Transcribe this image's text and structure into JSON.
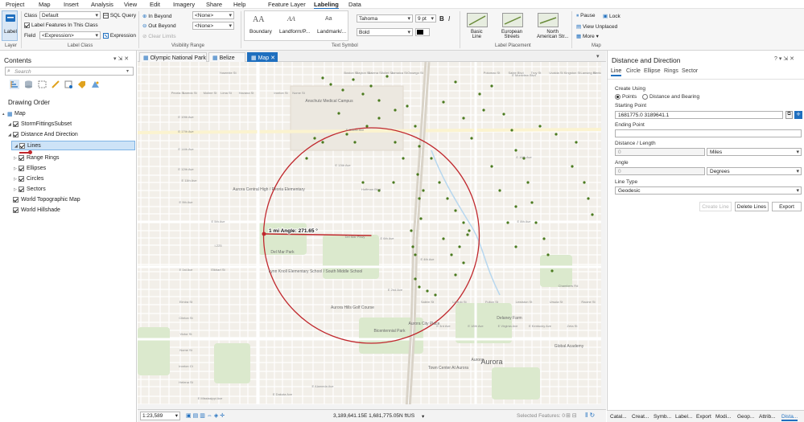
{
  "menu": [
    "Project",
    "Map",
    "Insert",
    "Analysis",
    "View",
    "Edit",
    "Imagery",
    "Share",
    "Help",
    "Feature Layer",
    "Labeling",
    "Data"
  ],
  "menu_active": "Labeling",
  "ribbon": {
    "label_button": "Label",
    "layer_group": "Layer",
    "class_label": "Class",
    "class_value": "Default",
    "sql_query": "SQL Query",
    "label_features": "Label Features In This Class",
    "field_label": "Field",
    "field_value": "<Expression>",
    "expression": "Expression",
    "label_class_group": "Label Class",
    "in_beyond": "In Beyond",
    "out_beyond": "Out Beyond",
    "clear_limits": "Clear Limits",
    "none1": "<None>",
    "none2": "<None>",
    "visibility_group": "Visibility Range",
    "styles": [
      "Boundary",
      "Landform/P...",
      "Landmark/..."
    ],
    "font_name": "Tahoma",
    "font_size": "9 pt",
    "font_style": "Bold",
    "text_symbol_group": "Text Symbol",
    "placements": [
      "Basic\nLine",
      "European\nStreets",
      "North\nAmerican Str..."
    ],
    "placement_group": "Label Placement",
    "pause": "Pause",
    "lock": "Lock",
    "view_unplaced": "View Unplaced",
    "more": "More",
    "map_group": "Map"
  },
  "contents": {
    "title": "Contents",
    "search_placeholder": "Search",
    "drawing_order": "Drawing Order",
    "items": [
      {
        "label": "Map",
        "indent": 0,
        "check": false,
        "expander": "▴"
      },
      {
        "label": "StormFittingsSubset",
        "indent": 1,
        "check": true,
        "expander": "◢"
      },
      {
        "label": "Distance And Direction",
        "indent": 1,
        "check": true,
        "expander": "◢"
      },
      {
        "label": "Lines",
        "indent": 2,
        "check": true,
        "expander": "◢",
        "selected": true
      },
      {
        "label": "Range Rings",
        "indent": 2,
        "check": true,
        "expander": "▷"
      },
      {
        "label": "Ellipses",
        "indent": 2,
        "check": true,
        "expander": "▷"
      },
      {
        "label": "Circles",
        "indent": 2,
        "check": true,
        "expander": "▷"
      },
      {
        "label": "Sectors",
        "indent": 2,
        "check": true,
        "expander": "▷"
      },
      {
        "label": "World Topographic Map",
        "indent": 1,
        "check": true,
        "expander": ""
      },
      {
        "label": "World Hillshade",
        "indent": 1,
        "check": true,
        "expander": ""
      }
    ]
  },
  "tabs": [
    "Olympic National Park",
    "Belize",
    "Map"
  ],
  "active_tab": "Map",
  "map": {
    "annotation": "1 mi Angle: 271.65 °",
    "places": [
      "Anschutz Medical Campus",
      "Aurora Central High / Peoria Elementary",
      "Del Mar Park",
      "Lynn Knoll Elementary School / South Middle School",
      "Aurora Hills Golf Course",
      "Aurora City Place",
      "Aurora",
      "Town Center At Aurora",
      "Delaney Farm",
      "Global Academy",
      "Bicentennial Park",
      "E Colfax Ave",
      "E 13th Ave",
      "E 11th Ave",
      "E 6th Ave",
      "E 4th Ave",
      "E 2nd Ave",
      "E Alameda Ave",
      "E Exposition Ave",
      "E Mississippi Ave",
      "E 17th Ave",
      "E 14th Ave",
      "E 12th Ave",
      "E 9th Ave",
      "E Montview Blvd",
      "E 19th Ave",
      "E 16th Ave",
      "E 8th Ave",
      "E 1st Ave",
      "E Dakota Ave",
      "Del Mar Pkwy",
      "Hoffman Blvd",
      "Chambers Rd",
      "Peoria St",
      "Laredo St",
      "Moline St",
      "Lima St",
      "Havana St",
      "Ironton St",
      "Nome St",
      "Oswego St",
      "Potomac St",
      "Sable Blvd",
      "Troy St",
      "Uvalda St",
      "Kingston St",
      "Lansing St",
      "Kenton St",
      "Boston St",
      "Dayton St",
      "Galena St",
      "Joliet St",
      "Jamaica St",
      "Yosemite St",
      "Elmira St",
      "Clinton St",
      "Victor St",
      "Nome St",
      "Ironton Ct",
      "Helena St",
      "Salem St",
      "Laredo St",
      "Fulton St",
      "Lewiston St",
      "Ursula St",
      "Racine St",
      "E 3rd Ave",
      "E 18th Ave",
      "E Virginia Ave",
      "E Kentucky Ave",
      "Zeta St",
      "E 5th Ave",
      "I-225",
      "Elkhart St"
    ],
    "scale": "1:23,589",
    "coords": "3,189,641.15E 1,681,775.05N ftUS",
    "selected_features": "Selected Features: 0"
  },
  "panel": {
    "title": "Distance and Direction",
    "tabs": [
      "Line",
      "Circle",
      "Ellipse",
      "Rings",
      "Sector"
    ],
    "active_tab": "Line",
    "create_using": "Create Using",
    "radio_points": "Points",
    "radio_bearing": "Distance and Bearing",
    "starting_point_label": "Starting Point",
    "starting_point_value": "1681775.0 3189641.1",
    "ending_point_label": "Ending Point",
    "ending_point_value": "",
    "distance_label": "Distance / Length",
    "distance_value": "0",
    "distance_unit": "Miles",
    "angle_label": "Angle",
    "angle_value": "0",
    "angle_unit": "Degrees",
    "line_type_label": "Line Type",
    "line_type_value": "Geodesic",
    "btn_create": "Create Line",
    "btn_delete": "Delete Lines",
    "btn_export": "Export"
  },
  "bottom_tabs": [
    "Catal...",
    "Creat...",
    "Symb...",
    "Label...",
    "Export",
    "Modi...",
    "Geop...",
    "Attrib...",
    "Dista..."
  ],
  "colors": {
    "accent": "#1f6fbf",
    "circle": "#c0282d",
    "points": "#4a7a1e"
  }
}
